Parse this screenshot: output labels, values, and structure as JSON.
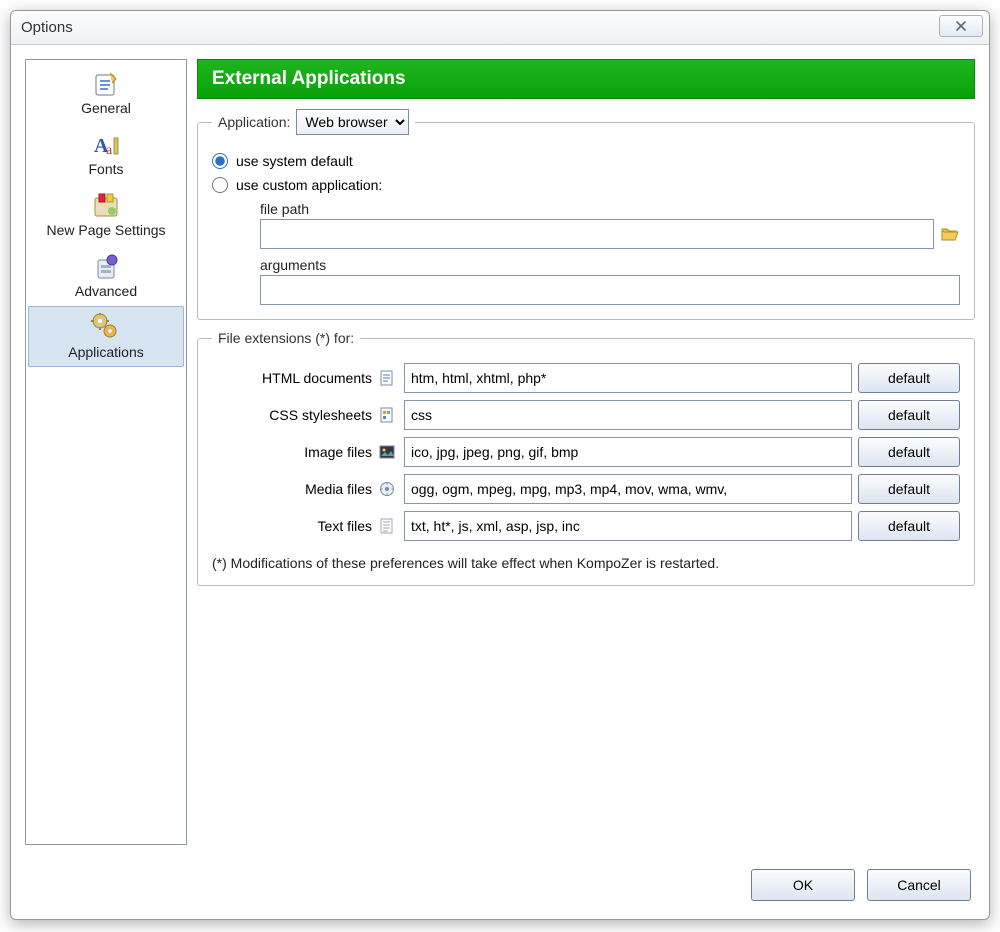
{
  "window": {
    "title": "Options"
  },
  "sidebar": {
    "items": [
      {
        "label": "General"
      },
      {
        "label": "Fonts"
      },
      {
        "label": "New Page Settings"
      },
      {
        "label": "Advanced"
      },
      {
        "label": "Applications"
      }
    ],
    "selected_index": 4
  },
  "panel": {
    "title": "External Applications",
    "application_label": "Application:",
    "application_dropdown": {
      "value": "Web browser"
    },
    "radio_system_label": "use system default",
    "radio_custom_label": "use custom application:",
    "radio_selected": "system",
    "file_path_label": "file path",
    "file_path_value": "",
    "arguments_label": "arguments",
    "arguments_value": "",
    "extensions_legend": "File extensions (*) for:",
    "rows": [
      {
        "label": "HTML documents",
        "value": "htm, html, xhtml, php*"
      },
      {
        "label": "CSS stylesheets",
        "value": "css"
      },
      {
        "label": "Image files",
        "value": "ico, jpg, jpeg, png, gif, bmp"
      },
      {
        "label": "Media files",
        "value": "ogg, ogm, mpeg, mpg, mp3, mp4, mov, wma, wmv,"
      },
      {
        "label": "Text files",
        "value": "txt, ht*, js, xml, asp, jsp, inc"
      }
    ],
    "default_button_label": "default",
    "note": "(*) Modifications of these preferences will take effect when KompoZer is restarted."
  },
  "footer": {
    "ok": "OK",
    "cancel": "Cancel"
  }
}
